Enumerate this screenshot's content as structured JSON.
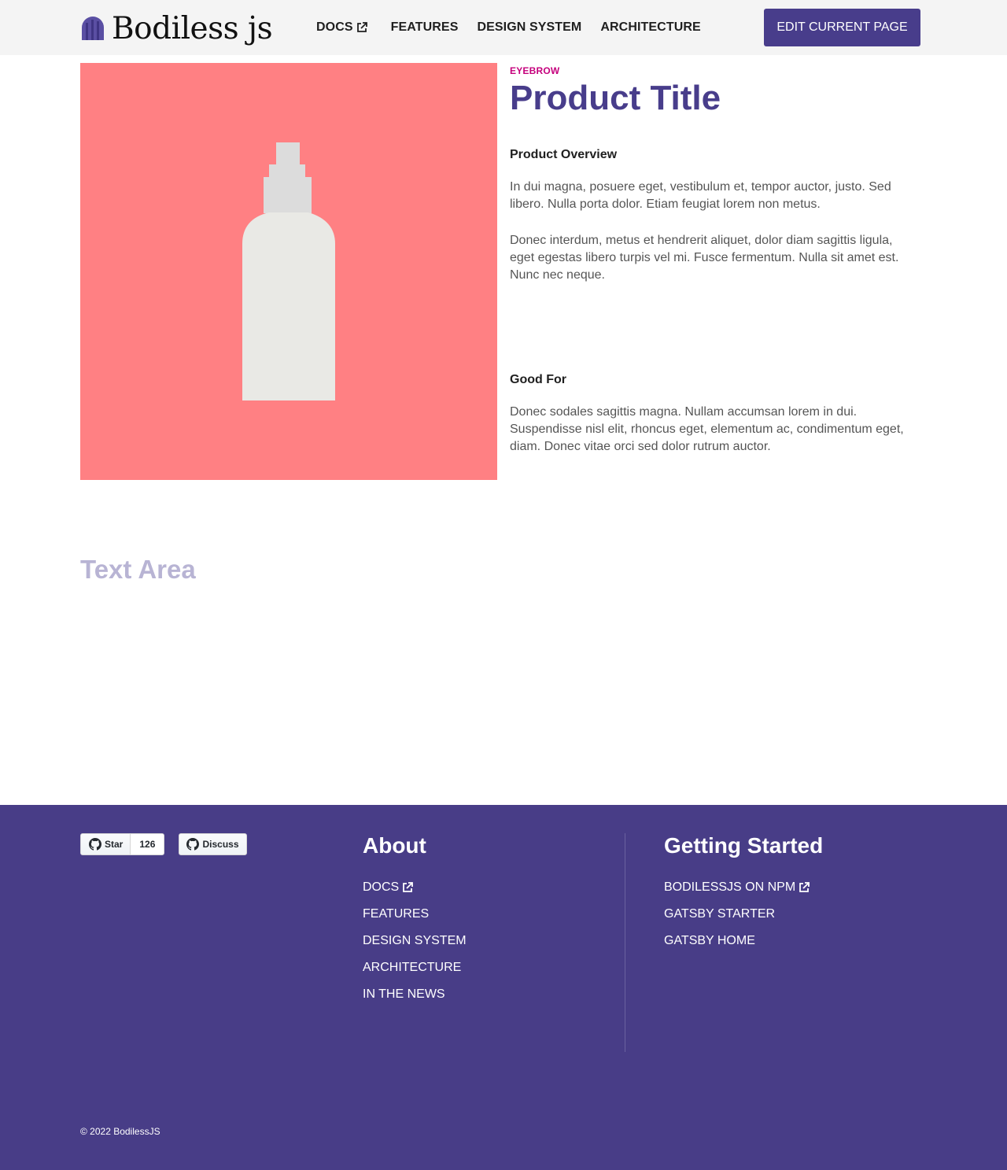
{
  "header": {
    "logo_text": "Bodiless js",
    "nav": [
      {
        "label": "DOCS",
        "external": true
      },
      {
        "label": "FEATURES"
      },
      {
        "label": "DESIGN SYSTEM"
      },
      {
        "label": "ARCHITECTURE"
      }
    ],
    "edit_button": "EDIT CURRENT PAGE"
  },
  "product": {
    "eyebrow": "EYEBROW",
    "title": "Product Title",
    "overview_heading": "Product Overview",
    "overview_paragraphs": [
      "In dui magna, posuere eget, vestibulum et, tempor auctor, justo. Sed libero. Nulla porta dolor. Etiam feugiat lorem non metus.",
      "Donec interdum, metus et hendrerit aliquet, dolor diam sagittis ligula, eget egestas libero turpis vel mi. Fusce fermentum. Nulla sit amet est. Nunc nec neque."
    ],
    "good_for_heading": "Good For",
    "good_for_text": "Donec sodales sagittis magna. Nullam accumsan lorem in dui. Suspendisse nisl elit, rhoncus eget, elementum ac, condimentum eget, diam. Donec vitae orci sed dolor rutrum auctor."
  },
  "text_area": {
    "placeholder": "Text Area"
  },
  "footer": {
    "github_star": {
      "label": "Star",
      "count": "126",
      "icon": "github-icon"
    },
    "github_discuss": {
      "label": "Discuss",
      "icon": "github-icon"
    },
    "about": {
      "heading": "About",
      "links": [
        {
          "label": "DOCS",
          "external": true
        },
        {
          "label": "FEATURES"
        },
        {
          "label": "DESIGN SYSTEM"
        },
        {
          "label": "ARCHITECTURE"
        },
        {
          "label": "IN THE NEWS"
        }
      ]
    },
    "getting_started": {
      "heading": "Getting Started",
      "links": [
        {
          "label": "BODILESSJS ON NPM",
          "external": true
        },
        {
          "label": "GATSBY STARTER"
        },
        {
          "label": "GATSBY HOME"
        }
      ]
    },
    "copyright": "©  2022 BodilessJS"
  },
  "colors": {
    "brand": "#483d8b",
    "eyebrow": "#c5007c",
    "image_bg": "#ff8083",
    "footer_bg": "#483d87"
  }
}
